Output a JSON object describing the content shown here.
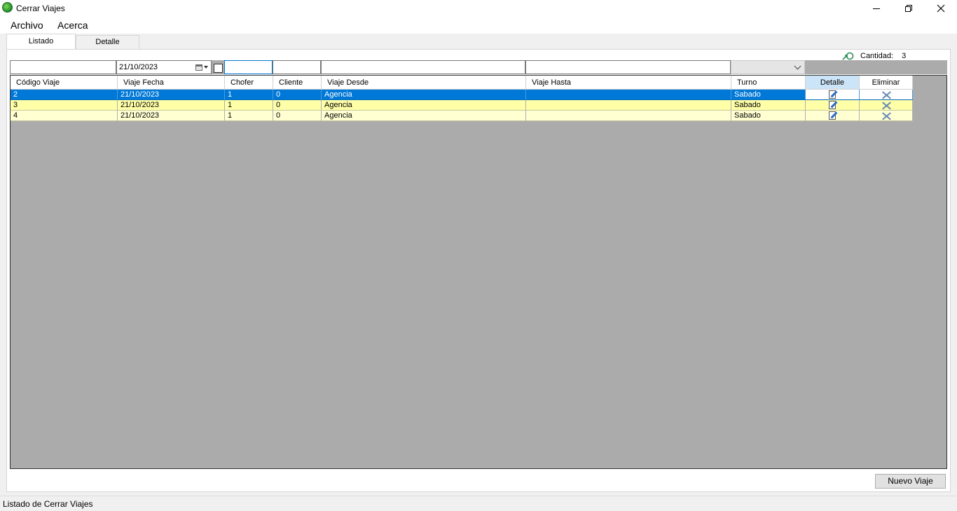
{
  "window": {
    "title": "Cerrar Viajes",
    "app_icon": "globe-icon",
    "controls": [
      "minimize-icon",
      "restore-icon",
      "close-icon"
    ]
  },
  "menu": {
    "items": [
      "Archivo",
      "Acerca"
    ]
  },
  "tabs": [
    {
      "label": "Listado",
      "active": true
    },
    {
      "label": "Detalle",
      "active": false
    }
  ],
  "cantidad": {
    "icon": "refresh-icon",
    "label": "Cantidad:",
    "value": "3"
  },
  "filters": {
    "fecha": "21/10/2023"
  },
  "grid": {
    "columns": [
      "Código Viaje",
      "Viaje Fecha",
      "Chofer",
      "Cliente",
      "Viaje Desde",
      "Viaje Hasta",
      "Turno",
      "Detalle",
      "Eliminar"
    ],
    "rows": [
      {
        "codigo": "2",
        "fecha": "21/10/2023",
        "chofer": "1",
        "cliente": "0",
        "desde": "Agencia",
        "hasta": "",
        "turno": "Sabado",
        "style": "selected"
      },
      {
        "codigo": "3",
        "fecha": "21/10/2023",
        "chofer": "1",
        "cliente": "0",
        "desde": "Agencia",
        "hasta": "",
        "turno": "Sabado",
        "style": "yellow"
      },
      {
        "codigo": "4",
        "fecha": "21/10/2023",
        "chofer": "1",
        "cliente": "0",
        "desde": "Agencia",
        "hasta": "",
        "turno": "Sabado",
        "style": "light"
      }
    ],
    "detalle_icon": "edit-icon",
    "eliminar_icon": "delete-icon"
  },
  "buttons": {
    "nuevo_viaje": "Nuevo Viaje"
  },
  "status": {
    "text": "Listado de Cerrar Viajes"
  },
  "colors": {
    "selected_row": "#0078d7",
    "row_yellow": "#ffffa8",
    "row_light_yellow": "#ffffd2",
    "grid_background": "#ababab"
  }
}
